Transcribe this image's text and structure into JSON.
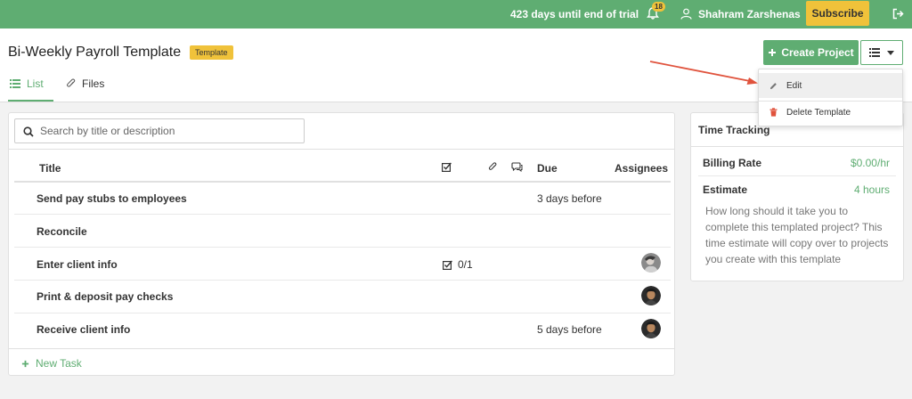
{
  "topbar": {
    "trial_text": "423 days until end of trial",
    "notification_count": "18",
    "user_name": "Shahram Zarshenas",
    "subscribe_label": "Subscribe",
    "bg_color": "#5fad72",
    "accent_color": "#f0c23a"
  },
  "header": {
    "title": "Bi-Weekly Payroll Template",
    "badge": "Template",
    "create_label": "Create Project",
    "tabs": [
      {
        "label": "List",
        "icon": "list-icon",
        "active": true
      },
      {
        "label": "Files",
        "icon": "paperclip-icon",
        "active": false
      }
    ]
  },
  "dropdown": {
    "items": [
      {
        "label": "Edit",
        "icon": "pencil-icon"
      },
      {
        "label": "Delete Template",
        "icon": "trash-icon"
      }
    ]
  },
  "search": {
    "placeholder": "Search by title or description",
    "value": ""
  },
  "table": {
    "columns": {
      "title": "Title",
      "due": "Due",
      "assignees": "Assignees"
    },
    "rows": [
      {
        "title": "Send pay stubs to employees",
        "due": "3 days before",
        "checklist": "",
        "has_avatar": false
      },
      {
        "title": "Reconcile",
        "due": "",
        "checklist": "",
        "has_avatar": false
      },
      {
        "title": "Enter client info",
        "due": "",
        "checklist": "0/1",
        "has_avatar": true
      },
      {
        "title": "Print & deposit pay checks",
        "due": "",
        "checklist": "",
        "has_avatar": true
      },
      {
        "title": "Receive client info",
        "due": "5 days before",
        "checklist": "",
        "has_avatar": true
      }
    ],
    "new_task_label": "New Task"
  },
  "time_tracking": {
    "title": "Time Tracking",
    "billing_rate_label": "Billing Rate",
    "billing_rate_value": "$0.00/hr",
    "estimate_label": "Estimate",
    "estimate_value": "4 hours",
    "description": "How long should it take you to complete this templated project? This time estimate will copy over to projects you create with this template"
  }
}
